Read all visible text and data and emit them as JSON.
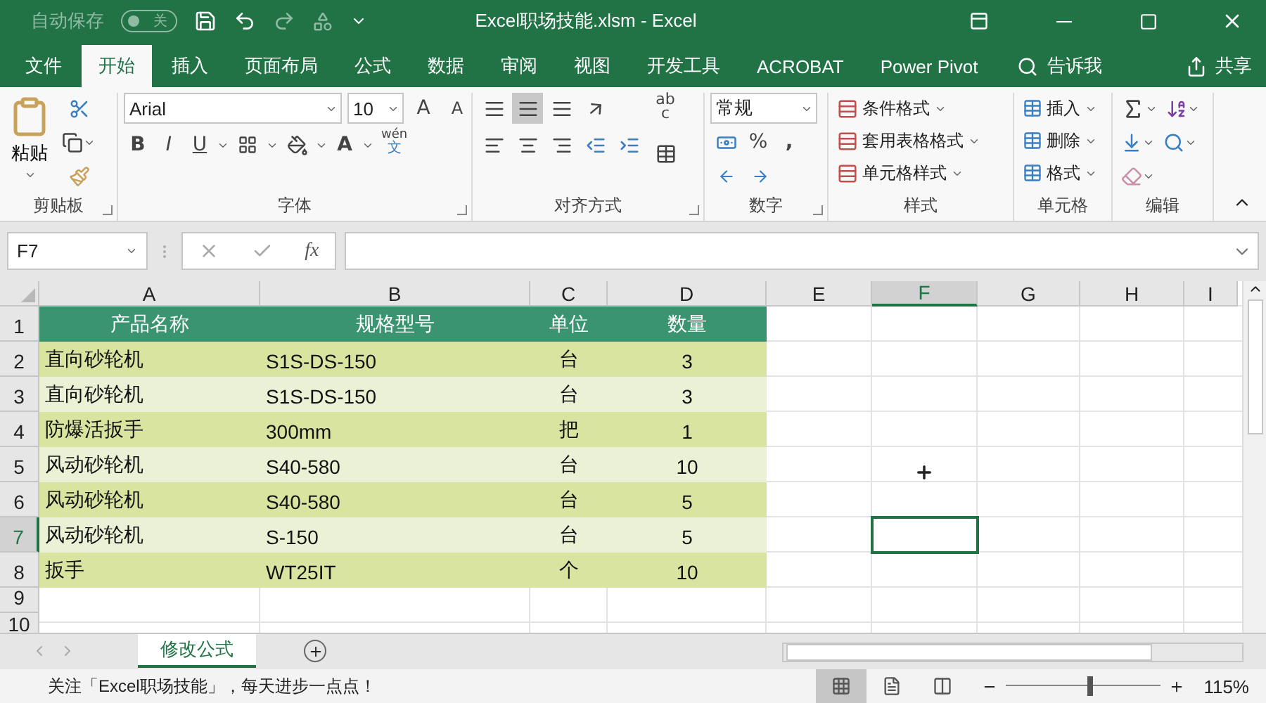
{
  "quick_access": {
    "autosave_label": "自动保存",
    "autosave_toggle": {
      "label": "关",
      "on": false
    }
  },
  "window": {
    "title": "Excel职场技能.xlsm  -  Excel"
  },
  "ribbon_tabs": [
    {
      "label": "文件",
      "selected": false
    },
    {
      "label": "开始",
      "selected": true
    },
    {
      "label": "插入",
      "selected": false
    },
    {
      "label": "页面布局",
      "selected": false
    },
    {
      "label": "公式",
      "selected": false
    },
    {
      "label": "数据",
      "selected": false
    },
    {
      "label": "审阅",
      "selected": false
    },
    {
      "label": "视图",
      "selected": false
    },
    {
      "label": "开发工具",
      "selected": false
    },
    {
      "label": "ACROBAT",
      "selected": false
    },
    {
      "label": "Power Pivot",
      "selected": false
    }
  ],
  "tell_me": "告诉我",
  "share": "共享",
  "clipboard": {
    "paste": "粘贴",
    "label": "剪贴板"
  },
  "font": {
    "name": "Arial",
    "size": "10",
    "grow": "A",
    "shrink": "A",
    "bold": "B",
    "italic": "I",
    "underline": "U",
    "font_color": "A",
    "phonetic_top": "wén",
    "phonetic_bottom": "文",
    "label": "字体"
  },
  "alignment": {
    "label": "对齐方式",
    "wrap_top": "ab",
    "wrap_bottom": "c"
  },
  "number": {
    "format": "常规",
    "percent": "%",
    "comma": ",",
    "label": "数字"
  },
  "styles": {
    "items": [
      "条件格式",
      "套用表格格式",
      "单元格样式"
    ],
    "label": "样式"
  },
  "cells": {
    "items": [
      "插入",
      "删除",
      "格式"
    ],
    "label": "单元格"
  },
  "editing": {
    "label": "编辑"
  },
  "formula_bar": {
    "name_box": "F7",
    "fx": "fx"
  },
  "columns": [
    {
      "label": "A",
      "selected": false
    },
    {
      "label": "B",
      "selected": false
    },
    {
      "label": "C",
      "selected": false
    },
    {
      "label": "D",
      "selected": false
    },
    {
      "label": "E",
      "selected": false
    },
    {
      "label": "F",
      "selected": true
    },
    {
      "label": "G",
      "selected": false
    },
    {
      "label": "H",
      "selected": false
    },
    {
      "label": "I",
      "selected": false
    }
  ],
  "rows": [
    {
      "label": "1",
      "selected": false
    },
    {
      "label": "2",
      "selected": false
    },
    {
      "label": "3",
      "selected": false
    },
    {
      "label": "4",
      "selected": false
    },
    {
      "label": "5",
      "selected": false
    },
    {
      "label": "6",
      "selected": false
    },
    {
      "label": "7",
      "selected": true
    },
    {
      "label": "8",
      "selected": false
    },
    {
      "label": "9",
      "selected": false
    },
    {
      "label": "10",
      "selected": false
    }
  ],
  "table": {
    "header": [
      "产品名称",
      "规格型号",
      "单位",
      "数量"
    ],
    "rows": [
      [
        "直向砂轮机",
        "S1S-DS-150",
        "台",
        "3"
      ],
      [
        "直向砂轮机",
        "S1S-DS-150",
        "台",
        "3"
      ],
      [
        "防爆活扳手",
        "300mm",
        "把",
        "1"
      ],
      [
        "风动砂轮机",
        "S40-580",
        "台",
        "10"
      ],
      [
        "风动砂轮机",
        "S40-580",
        "台",
        "5"
      ],
      [
        "风动砂轮机",
        "S-150",
        "台",
        "5"
      ],
      [
        "扳手",
        "WT25IT",
        "个",
        "10"
      ]
    ]
  },
  "sheet_tabs": [
    {
      "label": "修改公式",
      "selected": true
    }
  ],
  "status_bar": {
    "message": "关注「Excel职场技能」，每天进步一点点！",
    "views": [
      {
        "kind": "normal",
        "selected": true
      },
      {
        "kind": "page_layout",
        "selected": false
      },
      {
        "kind": "page_break",
        "selected": false
      }
    ],
    "zoom": {
      "level": 0.55,
      "reading": "115%"
    }
  }
}
